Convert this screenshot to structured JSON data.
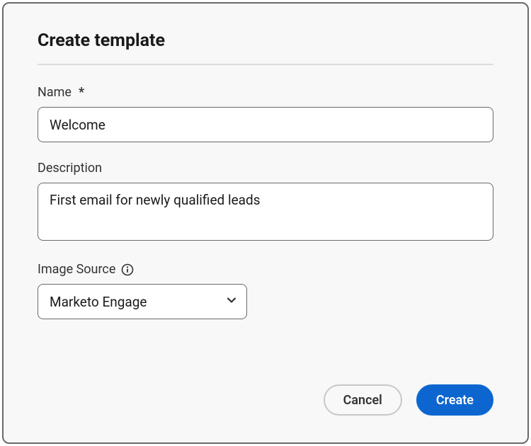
{
  "dialog": {
    "title": "Create template",
    "fields": {
      "name": {
        "label": "Name",
        "required_marker": "*",
        "value": "Welcome"
      },
      "description": {
        "label": "Description",
        "value": "First email for newly qualified leads"
      },
      "image_source": {
        "label": "Image Source",
        "selected": "Marketo Engage"
      }
    },
    "buttons": {
      "cancel": "Cancel",
      "create": "Create"
    }
  }
}
